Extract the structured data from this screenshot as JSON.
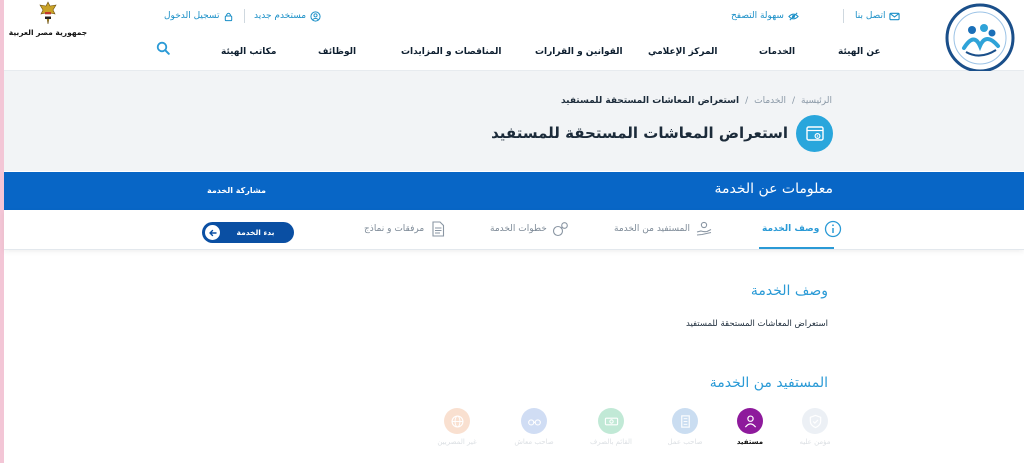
{
  "header": {
    "logo_left_text": "جمهورية مصر العربية",
    "utility": {
      "contact": "اتصل بنا",
      "accessibility": "سهولة التصفح",
      "new_user": "مستخدم جديد",
      "login": "تسجيل الدخول"
    },
    "nav": [
      "عن الهيئة",
      "الخدمات",
      "المركز الإعلامي",
      "القوانين و القرارات",
      "المناقصات و المزايدات",
      "الوظائف",
      "مكاتب الهيئة"
    ]
  },
  "breadcrumb": {
    "home": "الرئيسية",
    "separator": "/",
    "services": "الخدمات",
    "current": "استعراض المعاشات المستحقة للمستفيد"
  },
  "page_title": "استعراض المعاشات المستحقة للمستفيد",
  "info_band": {
    "title": "معلومات عن الخدمة",
    "share": "مشاركة الخدمة"
  },
  "tabs": [
    {
      "label": "وصف الخدمة",
      "icon": "info-icon",
      "active": true
    },
    {
      "label": "المستفيد من الخدمة",
      "icon": "beneficiary-hand-icon",
      "active": false
    },
    {
      "label": "خطوات الخدمة",
      "icon": "steps-icon",
      "active": false
    },
    {
      "label": "مرفقات و نماذج",
      "icon": "document-icon",
      "active": false
    }
  ],
  "start_button": "بدء الخدمة",
  "description": {
    "heading": "وصف الخدمة",
    "text": "استعراض المعاشات المستحقة للمستفيد"
  },
  "beneficiaries": {
    "heading": "المستفيد من الخدمة",
    "items": [
      {
        "label": "مؤمن عليه",
        "icon": "shield-icon",
        "color": "#8aa3c2",
        "active": false
      },
      {
        "label": "مستفيد",
        "icon": "user-icon",
        "color": "#8e1a9c",
        "active": true
      },
      {
        "label": "صاحب عمل",
        "icon": "building-icon",
        "color": "#6aa0d8",
        "active": false
      },
      {
        "label": "القائم بالصرف",
        "icon": "money-icon",
        "color": "#4fc18c",
        "active": false
      },
      {
        "label": "صاحب معاش",
        "icon": "glasses-icon",
        "color": "#7b9fe0",
        "active": false
      },
      {
        "label": "غير المصريين",
        "icon": "globe-icon",
        "color": "#f0a77a",
        "active": false
      }
    ]
  },
  "colors": {
    "primary_blue": "#0866c6",
    "accent_cyan": "#2a9ad6",
    "start_button": "#0a4fa3"
  }
}
